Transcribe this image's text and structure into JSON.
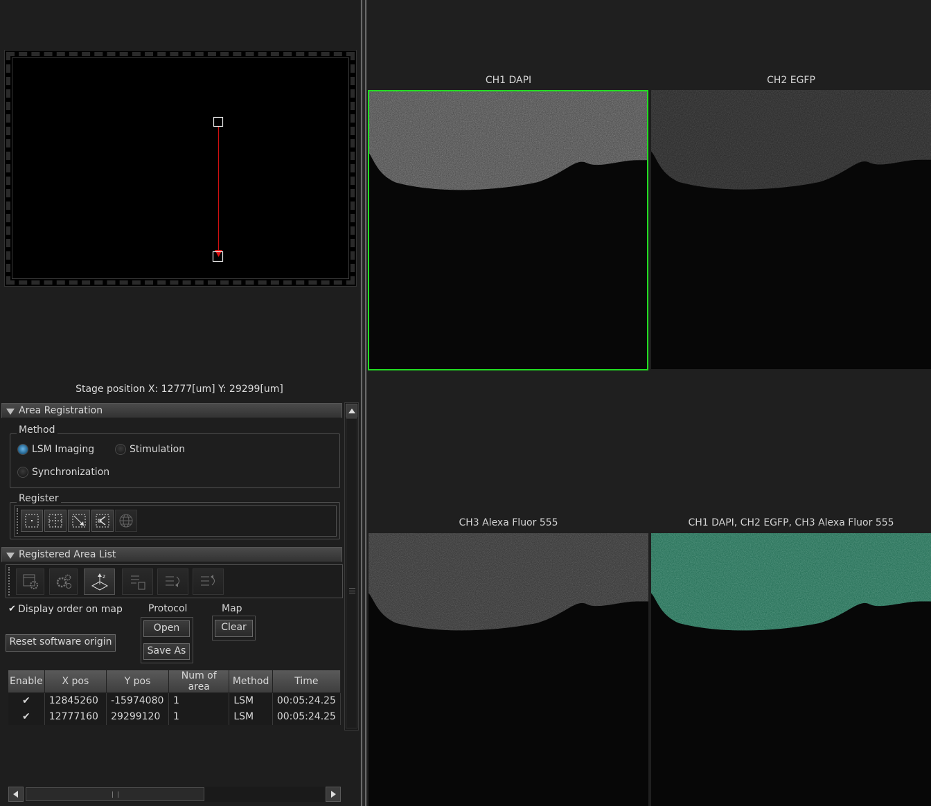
{
  "stage_position": "Stage position  X: 12777[um] Y: 29299[um]",
  "area_registration": {
    "header": "Area Registration",
    "method_label": "Method",
    "methods": [
      {
        "label": "LSM Imaging",
        "selected": true
      },
      {
        "label": "Stimulation",
        "selected": false
      },
      {
        "label": "Synchronization",
        "selected": false
      }
    ],
    "register_label": "Register",
    "register_tools": [
      "point-region-icon",
      "grid-region-icon",
      "diagonal-region-icon",
      "polygon-region-icon",
      "globe-region-icon"
    ]
  },
  "registered_list": {
    "header": "Registered Area List",
    "tools": [
      "area-settings-icon",
      "gear-settings-icon",
      "z-stack-icon",
      "delete-list-icon",
      "reorder-icon",
      "reorder-back-icon"
    ],
    "display_order": {
      "label": "Display order on map",
      "checked": true
    },
    "protocol_label": "Protocol",
    "open_label": "Open",
    "save_as_label": "Save As",
    "map_label": "Map",
    "clear_label": "Clear",
    "reset_origin_label": "Reset software origin",
    "columns": [
      "Enable",
      "X pos",
      "Y pos",
      "Num of area",
      "Method",
      "Time"
    ],
    "rows": [
      {
        "enable": "✔",
        "x": "12845260",
        "y": "-15974080",
        "num": "1",
        "method": "LSM",
        "time": "00:05:24.25"
      },
      {
        "enable": "✔",
        "x": "12777160",
        "y": "29299120",
        "num": "1",
        "method": "LSM",
        "time": "00:05:24.25"
      }
    ]
  },
  "channels": [
    {
      "label": "CH1 DAPI",
      "tint": "#ffffff",
      "brightness": 0.75,
      "selected": true
    },
    {
      "label": "CH2 EGFP",
      "tint": "#ffffff",
      "brightness": 0.3,
      "selected": false
    },
    {
      "label": "CH3 Alexa Fluor 555",
      "tint": "#ffffff",
      "brightness": 0.45,
      "selected": false
    },
    {
      "label": "CH1 DAPI, CH2 EGFP, CH3 Alexa Fluor 555",
      "tint": "#2fbf8f",
      "brightness": 0.85,
      "selected": false
    }
  ],
  "colors": {
    "selection_outline": "#22dd22",
    "map_line": "#d01010"
  }
}
